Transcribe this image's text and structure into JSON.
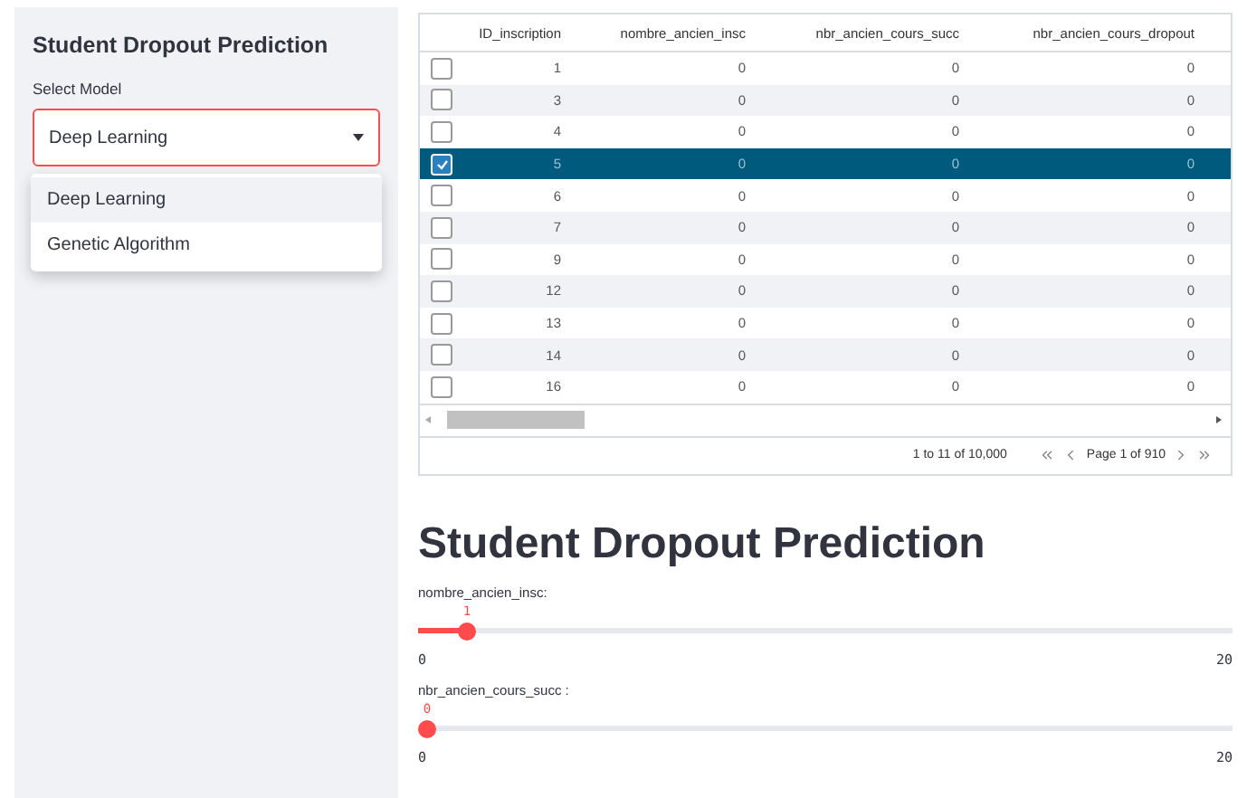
{
  "sidebar": {
    "title": "Student Dropout Prediction",
    "select_label": "Select Model",
    "select_value": "Deep Learning",
    "dropdown_open": true,
    "options": [
      {
        "label": "Deep Learning",
        "selected": true
      },
      {
        "label": "Genetic Algorithm",
        "selected": false
      }
    ]
  },
  "table": {
    "columns": [
      "ID_inscription",
      "nombre_ancien_insc",
      "nbr_ancien_cours_succ",
      "nbr_ancien_cours_dropout"
    ],
    "rows": [
      {
        "cells": [
          "1",
          "0",
          "0",
          "0"
        ],
        "selected": false
      },
      {
        "cells": [
          "3",
          "0",
          "0",
          "0"
        ],
        "selected": false
      },
      {
        "cells": [
          "4",
          "0",
          "0",
          "0"
        ],
        "selected": false
      },
      {
        "cells": [
          "5",
          "0",
          "0",
          "0"
        ],
        "selected": true
      },
      {
        "cells": [
          "6",
          "0",
          "0",
          "0"
        ],
        "selected": false
      },
      {
        "cells": [
          "7",
          "0",
          "0",
          "0"
        ],
        "selected": false
      },
      {
        "cells": [
          "9",
          "0",
          "0",
          "0"
        ],
        "selected": false
      },
      {
        "cells": [
          "12",
          "0",
          "0",
          "0"
        ],
        "selected": false
      },
      {
        "cells": [
          "13",
          "0",
          "0",
          "0"
        ],
        "selected": false
      },
      {
        "cells": [
          "14",
          "0",
          "0",
          "0"
        ],
        "selected": false
      },
      {
        "cells": [
          "16",
          "0",
          "0",
          "0"
        ],
        "selected": false
      }
    ],
    "row_count": "1 to 11 of 10,000",
    "page": "Page 1 of 910"
  },
  "heading": "Student Dropout Prediction",
  "sliders": [
    {
      "label": "nombre_ancien_insc:",
      "value": "1",
      "level": 0.05,
      "min": "0",
      "max": "20"
    },
    {
      "label": "nbr_ancien_cours_succ :",
      "value": "0",
      "level": 0,
      "min": "0",
      "max": "20"
    }
  ]
}
